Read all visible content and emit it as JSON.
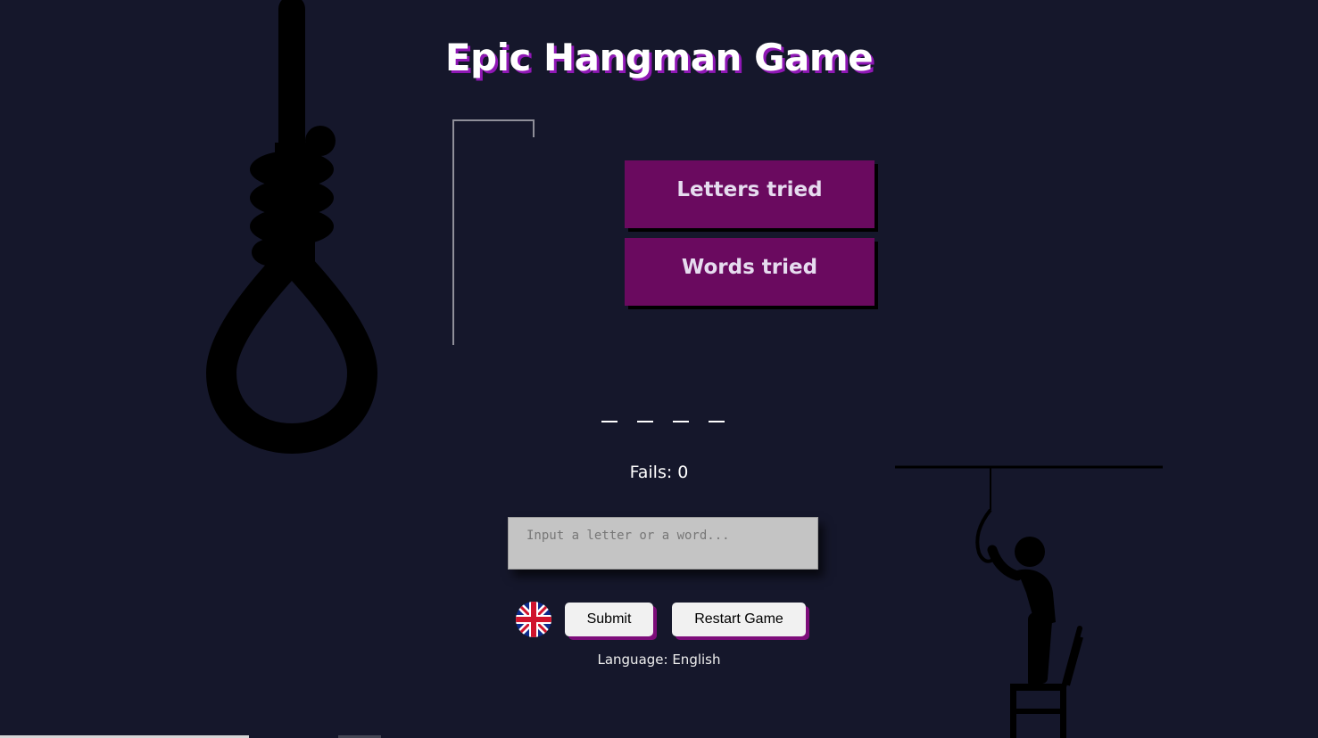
{
  "title": "Epic Hangman Game",
  "panels": {
    "letters_tried_label": "Letters tried",
    "words_tried_label": "Words tried"
  },
  "word": {
    "slots": [
      "_",
      "_",
      "_",
      "_"
    ]
  },
  "status": {
    "fails_text": "Fails: 0"
  },
  "guess_input": {
    "value": "",
    "placeholder": "Input a letter or a word..."
  },
  "buttons": {
    "submit_label": "Submit",
    "restart_label": "Restart Game"
  },
  "language": {
    "flag_icon": "uk-flag-icon",
    "label": "Language: English"
  },
  "colors": {
    "background": "#15172b",
    "panel": "#6a0a5f",
    "title_shadow": "#8f17b5",
    "button_shadow": "#7d0d7a"
  }
}
